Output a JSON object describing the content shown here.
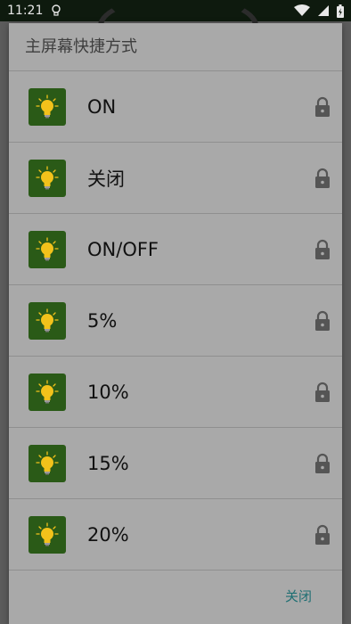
{
  "status_bar": {
    "time": "11:21",
    "icons": [
      "lightbulb-outline-icon",
      "wifi-icon",
      "signal-icon",
      "battery-charging-icon"
    ]
  },
  "dialog": {
    "title": "主屏幕快捷方式",
    "close_label": "关闭",
    "items": [
      {
        "label": "ON",
        "icon": "lightbulb-icon",
        "locked": true
      },
      {
        "label": "关闭",
        "icon": "lightbulb-icon",
        "locked": true
      },
      {
        "label": "ON/OFF",
        "icon": "lightbulb-icon",
        "locked": true
      },
      {
        "label": "5%",
        "icon": "lightbulb-icon",
        "locked": true
      },
      {
        "label": "10%",
        "icon": "lightbulb-icon",
        "locked": true
      },
      {
        "label": "15%",
        "icon": "lightbulb-icon",
        "locked": true
      },
      {
        "label": "20%",
        "icon": "lightbulb-icon",
        "locked": true
      }
    ]
  },
  "colors": {
    "dialog_bg": "#a9a9a9",
    "icon_bg": "#2a5a17",
    "bulb": "#f2c21b",
    "accent": "#1f6f73"
  }
}
